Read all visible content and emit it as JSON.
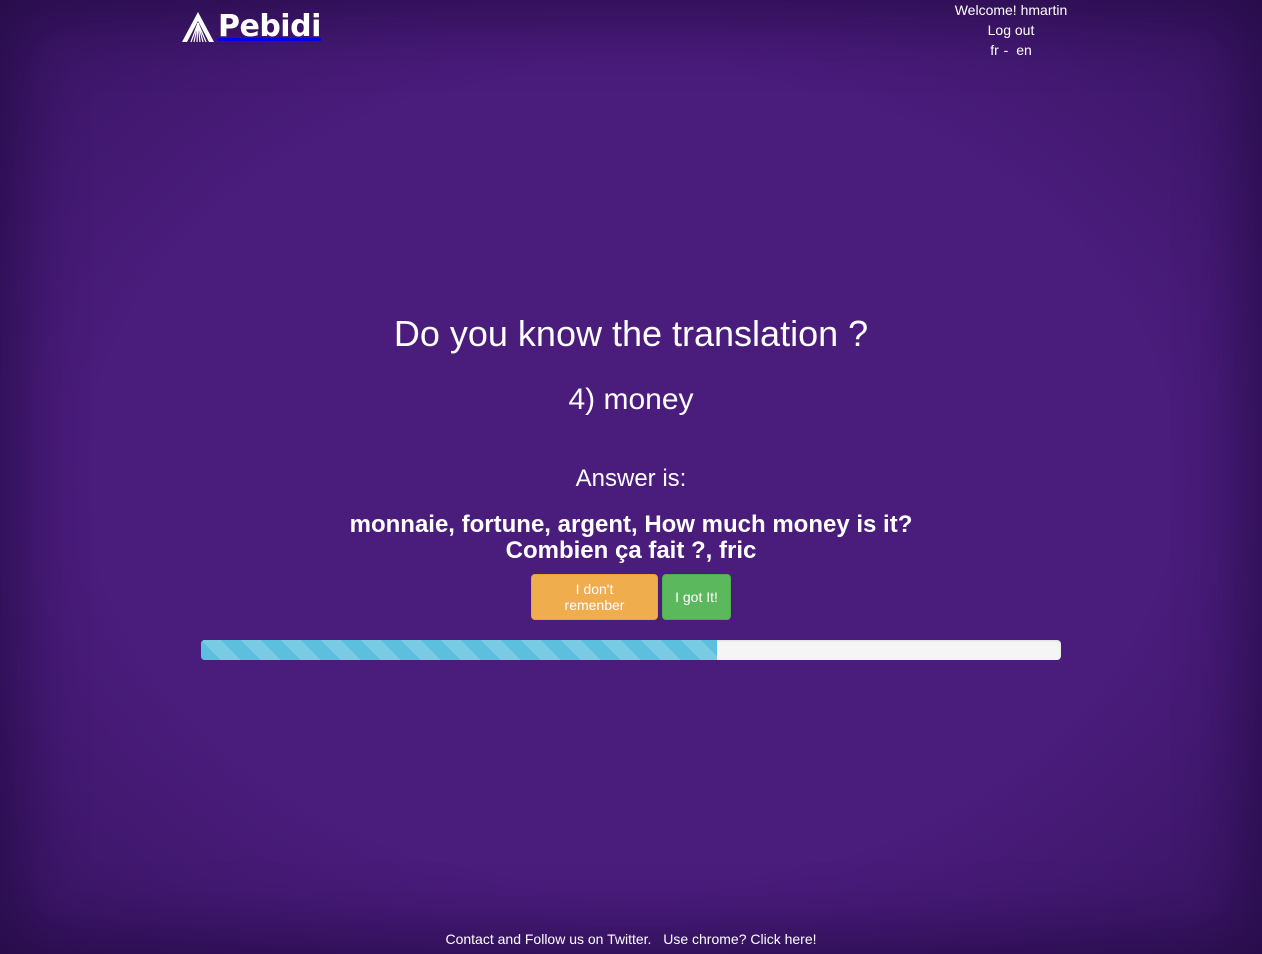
{
  "brand": {
    "name": "Pebidi",
    "logo_icon": "mountain-rays-icon"
  },
  "user_menu": {
    "welcome": "Welcome! hmartin",
    "logout": "Log out",
    "lang_fr": "fr",
    "lang_separator": "-",
    "lang_en": "en"
  },
  "quiz": {
    "question": "Do you know the translation ?",
    "word": "4) money",
    "answer_label": "Answer is:",
    "answer_text": "monnaie, fortune, argent, How much money is it? Combien ça fait ?, fric",
    "dont_remember_label": "I don't remenber",
    "got_it_label": "I got It!",
    "progress_fraction": 0.6
  },
  "footer": {
    "contact_text": "Contact and Follow us on Twitter.",
    "chrome_text": "Use chrome? Click here!"
  },
  "colors": {
    "background": "#4a1c7c",
    "warning_button": "#f0ad4e",
    "success_button": "#5cb85c",
    "progress_fill": "#5bc0de",
    "progress_track": "#f5f5f5"
  }
}
